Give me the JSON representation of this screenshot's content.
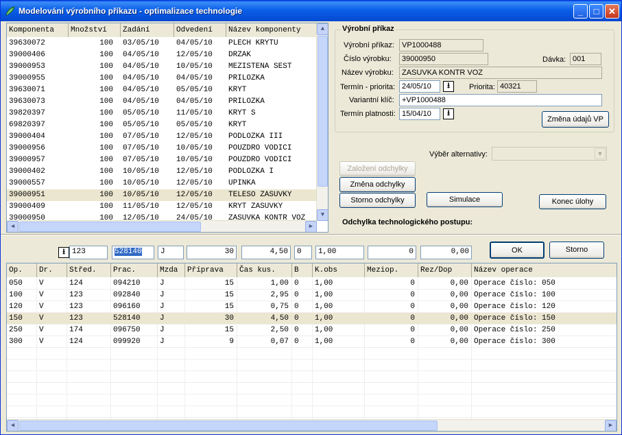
{
  "window": {
    "title": "Modelování výrobního příkazu - optimalizace technologie",
    "buttons": {
      "minimize": "_",
      "maximize": "□",
      "close": "✕"
    }
  },
  "components_grid": {
    "columns": [
      "Komponenta",
      "Množství",
      "Zadání",
      "Odvedení",
      "Název komponenty"
    ],
    "rows": [
      [
        "39630072",
        "100",
        "03/05/10",
        "04/05/10",
        "PLECH KRYTU"
      ],
      [
        "39000406",
        "100",
        "04/05/10",
        "12/05/10",
        "DRZAK"
      ],
      [
        "39000953",
        "100",
        "04/05/10",
        "10/05/10",
        "MEZISTENA SEST"
      ],
      [
        "39000955",
        "100",
        "04/05/10",
        "04/05/10",
        "PRILOZKA"
      ],
      [
        "39630071",
        "100",
        "04/05/10",
        "05/05/10",
        "KRYT"
      ],
      [
        "39630073",
        "100",
        "04/05/10",
        "04/05/10",
        "PRILOZKA"
      ],
      [
        "39820397",
        "100",
        "05/05/10",
        "11/05/10",
        "KRYT  S"
      ],
      [
        "69820397",
        "100",
        "05/05/10",
        "05/05/10",
        "KRYT"
      ],
      [
        "39000404",
        "100",
        "07/05/10",
        "12/05/10",
        "PODLOZKA III"
      ],
      [
        "39000956",
        "100",
        "07/05/10",
        "10/05/10",
        "POUZDRO VODICI"
      ],
      [
        "39000957",
        "100",
        "07/05/10",
        "10/05/10",
        "POUZDRO VODICI"
      ],
      [
        "39000402",
        "100",
        "10/05/10",
        "12/05/10",
        "PODLOZKA I"
      ],
      [
        "39000557",
        "100",
        "10/05/10",
        "12/05/10",
        "UPINKA"
      ],
      [
        "39000951",
        "100",
        "10/05/10",
        "12/05/10",
        "TELESO ZASUVKY"
      ],
      [
        "39000409",
        "100",
        "11/05/10",
        "12/05/10",
        "KRYT ZASUVKY"
      ],
      [
        "39000950",
        "100",
        "12/05/10",
        "24/05/10",
        "ZASUVKA KONTR VOZ"
      ]
    ],
    "selected_index": 13
  },
  "order": {
    "group_title": "Výrobní příkaz",
    "order_label": "Výrobní příkaz:",
    "order_value": "VP1000488",
    "product_no_label": "Číslo výrobku:",
    "product_no_value": "39000950",
    "batch_label": "Dávka:",
    "batch_value": "001",
    "product_name_label": "Název výrobku:",
    "product_name_value": "ZASUVKA KONTR VOZ",
    "term_label": "Termín - priorita:",
    "term_value": "24/05/10",
    "priority_label": "Priorita:",
    "priority_value": "40321",
    "variant_label": "Variantní klíč:",
    "variant_value": "+VP1000488",
    "validity_label": "Termín platnosti:",
    "validity_value": "15/04/10",
    "change_button": "Změna údajů VP"
  },
  "actions": {
    "alternative_label": "Výběr alternativy:",
    "create_deviation": "Založení odchylky",
    "change_deviation": "Změna odchylky",
    "cancel_deviation": "Storno odchylky",
    "simulation": "Simulace",
    "end_task": "Konec úlohy",
    "deviation_title": "Odchylka technologického postupu:"
  },
  "edit_row": {
    "stred": "123",
    "prac": "528140",
    "mzda": "J",
    "priprava": "30",
    "cas_kus": "4,50",
    "b": "0",
    "k_obs": "1,00",
    "meziop": "0",
    "rez_dop": "0,00",
    "ok": "OK",
    "storno": "Storno"
  },
  "operations_grid": {
    "columns": [
      "Op.",
      "Dr.",
      "Střed.",
      "Prac.",
      "Mzda",
      "Příprava",
      "Čas kus.",
      "B",
      "K.obs",
      "Meziop.",
      "Rez/Dop",
      "Název operace"
    ],
    "rows": [
      [
        "050",
        "V",
        "124",
        "094210",
        "J",
        "15",
        "1,00",
        "0",
        "1,00",
        "0",
        "0,00",
        "Operace číslo: 050"
      ],
      [
        "100",
        "V",
        "123",
        "092840",
        "J",
        "15",
        "2,95",
        "0",
        "1,00",
        "0",
        "0,00",
        "Operace číslo: 100"
      ],
      [
        "120",
        "V",
        "123",
        "096160",
        "J",
        "15",
        "0,75",
        "0",
        "1,00",
        "0",
        "0,00",
        "Operace číslo: 120"
      ],
      [
        "150",
        "V",
        "123",
        "528140",
        "J",
        "30",
        "4,50",
        "0",
        "1,00",
        "0",
        "0,00",
        "Operace číslo: 150"
      ],
      [
        "250",
        "V",
        "174",
        "096750",
        "J",
        "15",
        "2,50",
        "0",
        "1,00",
        "0",
        "0,00",
        "Operace číslo: 250"
      ],
      [
        "300",
        "V",
        "124",
        "099920",
        "J",
        "9",
        "0,07",
        "0",
        "1,00",
        "0",
        "0,00",
        "Operace číslo: 300"
      ]
    ],
    "selected_index": 3
  },
  "colors": {
    "title_bar": "#0a5fe9",
    "selection": "#ebe6d0",
    "highlight": "#316ac5",
    "face": "#ece9d8"
  }
}
